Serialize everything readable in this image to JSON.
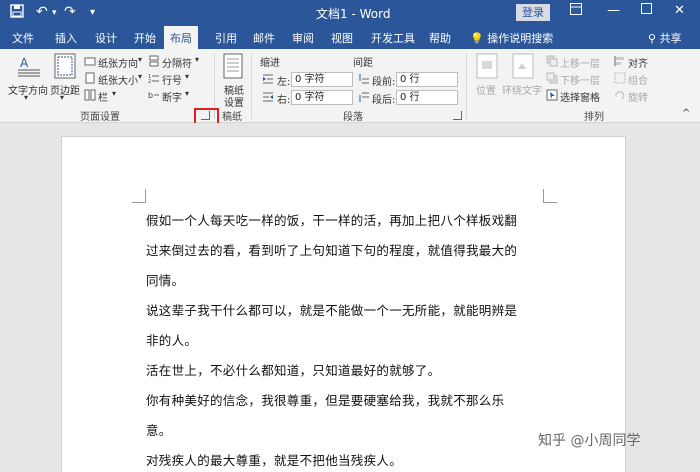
{
  "titlebar": {
    "doc_title": "文档1 - Word",
    "login": "登录"
  },
  "tabs": [
    "文件",
    "插入",
    "设计",
    "开始",
    "布局",
    "引用",
    "邮件",
    "审阅",
    "视图",
    "开发工具",
    "帮助"
  ],
  "active_tab": "布局",
  "tell_me": "操作说明搜索",
  "share": "共享",
  "ribbon": {
    "page_setup": {
      "text_direction": "文字方向",
      "margins": "页边距",
      "orientation": "纸张方向",
      "size": "纸张大小",
      "columns": "栏",
      "breaks": "分隔符",
      "line_numbers": "行号",
      "hyphenation": "断字",
      "label": "页面设置"
    },
    "manuscript": {
      "settings_line1": "稿纸",
      "settings_line2": "设置",
      "label": "稿纸"
    },
    "paragraph": {
      "indent_title": "缩进",
      "spacing_title": "间距",
      "left_label": "左:",
      "right_label": "右:",
      "left_value": "0 字符",
      "right_value": "0 字符",
      "before_label": "段前:",
      "after_label": "段后:",
      "before_value": "0 行",
      "after_value": "0 行",
      "label": "段落"
    },
    "arrange": {
      "position": "位置",
      "wrap_text": "环绕文字",
      "bring_forward": "上移一层",
      "send_backward": "下移一层",
      "selection_pane": "选择窗格",
      "align": "对齐",
      "group": "组合",
      "rotate": "旋转",
      "label": "排列"
    }
  },
  "document": {
    "lines": [
      "假如一个人每天吃一样的饭，干一样的活，再加上把八个样板戏翻",
      "过来倒过去的看，看到听了上句知道下句的程度，就值得我最大的",
      "同情。",
      "说这辈子我干什么都可以，就是不能做一个一无所能，就能明辨是",
      "非的人。",
      "活在世上，不必什么都知道，只知道最好的就够了。",
      "你有种美好的信念，我很尊重，但是要硬塞给我，我就不那么乐",
      "意。",
      "对残疾人的最大尊重，就是不把他当残疾人。"
    ]
  },
  "watermark": "知乎 @小周同学",
  "colors": {
    "word_blue": "#2b579a",
    "ribbon_bg": "#f3f3f3",
    "highlight": "#e02020"
  }
}
